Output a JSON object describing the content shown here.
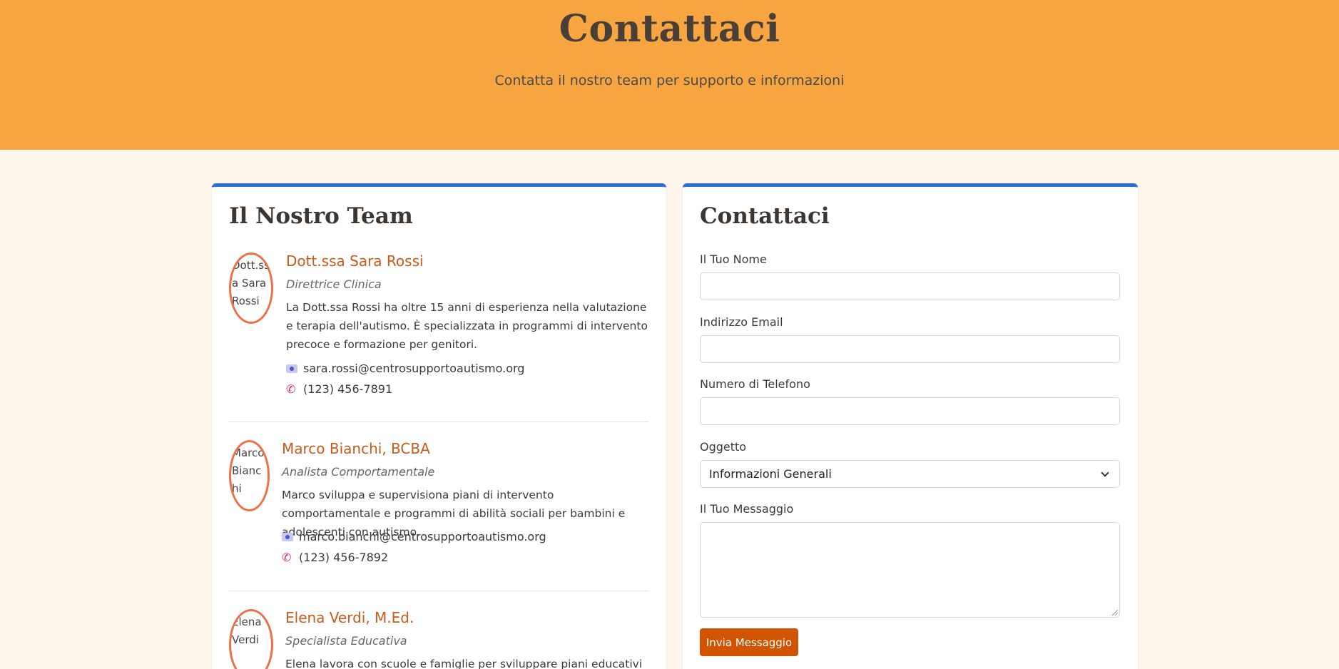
{
  "header": {
    "title": "Contattaci",
    "subtitle": "Contatta il nostro team per supporto e informazioni"
  },
  "team": {
    "title": "Il Nostro Team",
    "members": [
      {
        "alt": "Dott.ssa Sara Rossi",
        "name": "Dott.ssa Sara Rossi",
        "role": "Direttrice Clinica",
        "bio": "La Dott.ssa Rossi ha oltre 15 anni di esperienza nella valutazione e terapia dell'autismo. È specializzata in programmi di intervento precoce e formazione per genitori.",
        "email": "sara.rossi@centrosupportoautismo.org",
        "phone": "(123) 456-7891"
      },
      {
        "alt": "Marco Bianchi",
        "name": "Marco Bianchi, BCBA",
        "role": "Analista Comportamentale",
        "bio": "Marco sviluppa e supervisiona piani di intervento comportamentale e programmi di abilità sociali per bambini e adolescenti con autismo.",
        "email": "marco.bianchi@centrosupportoautismo.org",
        "phone": "(123) 456-7892"
      },
      {
        "alt": "Elena Verdi",
        "name": "Elena Verdi, M.Ed.",
        "role": "Specialista Educativa",
        "bio": "Elena lavora con scuole e famiglie per sviluppare piani educativi efficaci e"
      }
    ]
  },
  "form": {
    "title": "Contattaci",
    "name_label": "Il Tuo Nome",
    "email_label": "Indirizzo Email",
    "phone_label": "Numero di Telefono",
    "subject_label": "Oggetto",
    "subject_value": "Informazioni Generali",
    "message_label": "Il Tuo Messaggio",
    "submit_label": "Invia Messaggio"
  },
  "colors": {
    "hero": "#f6a540",
    "accent_border": "#2a6fdb",
    "name_color": "#c95a1b",
    "button": "#d35400",
    "avatar_ring": "#f07045"
  },
  "icons": {
    "email": "email-icon",
    "phone": "phone-icon"
  }
}
